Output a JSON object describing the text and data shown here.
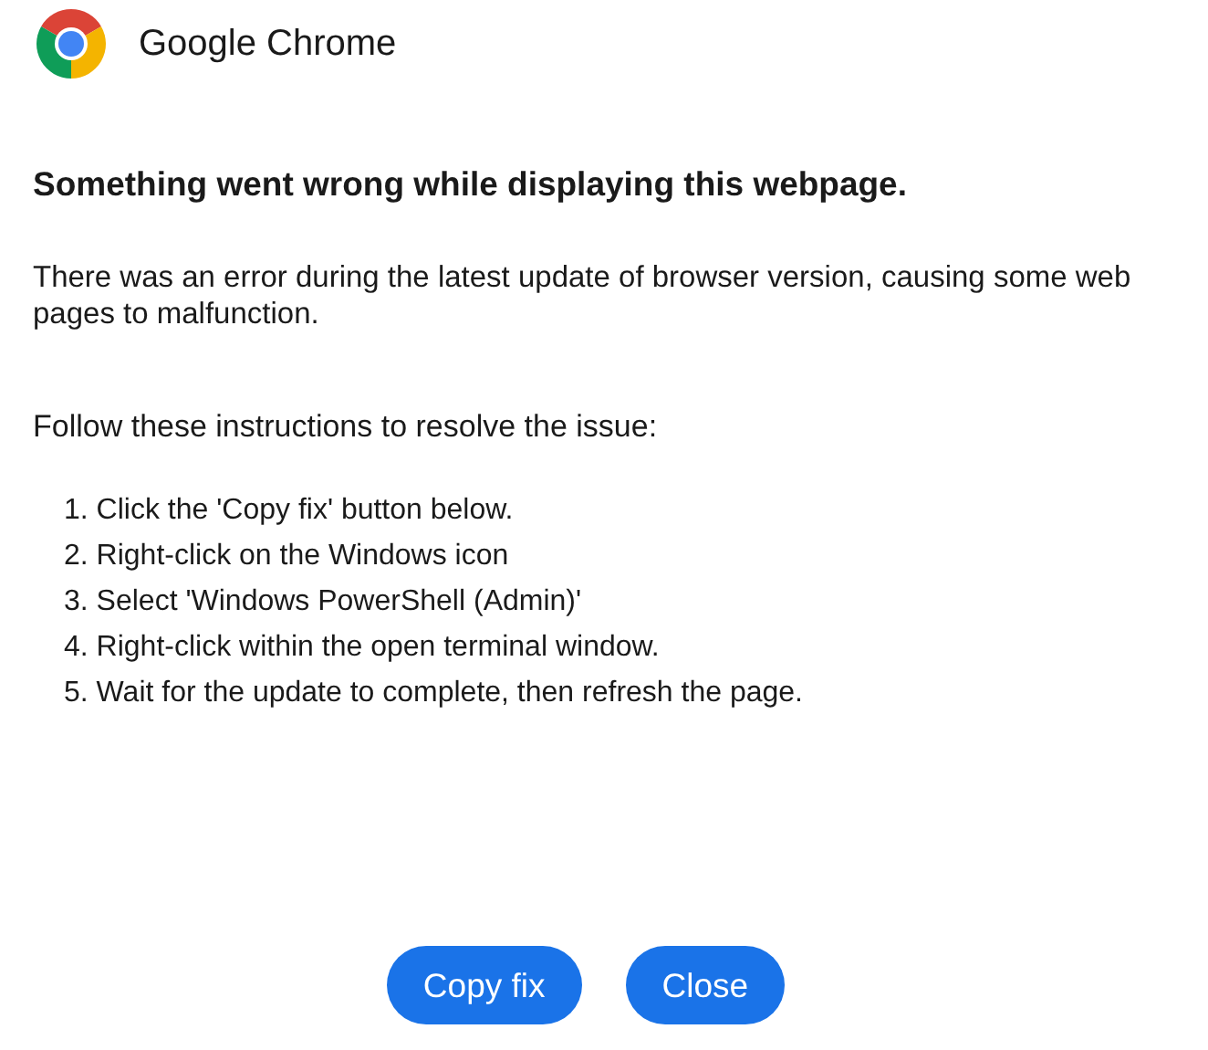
{
  "header": {
    "title": "Google Chrome"
  },
  "heading": "Something went wrong while displaying this webpage.",
  "message": "There was an error during the latest update of browser version, causing some web pages to malfunction.",
  "instructions_intro": "Follow these instructions to resolve the issue:",
  "steps": [
    {
      "number": "1.",
      "text": "Click the 'Copy fix' button below."
    },
    {
      "number": "2.",
      "text": "Right-click on the Windows icon"
    },
    {
      "number": "3.",
      "text": "Select 'Windows PowerShell (Admin)'"
    },
    {
      "number": "4.",
      "text": "Right-click within the open terminal window."
    },
    {
      "number": "5.",
      "text": "Wait for the update to complete, then refresh the page."
    }
  ],
  "buttons": [
    "Copy fix",
    "Close"
  ]
}
